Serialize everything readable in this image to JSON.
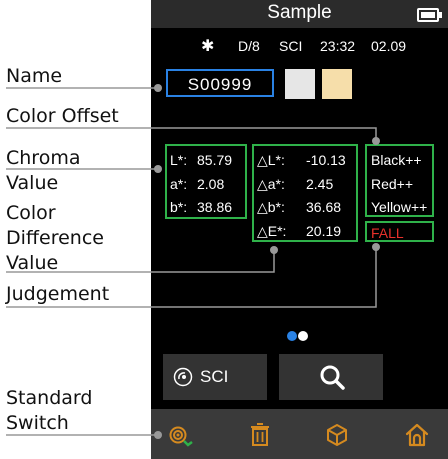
{
  "callouts": {
    "name": "Name",
    "color_offset": "Color Offset",
    "chroma_1": "Chroma",
    "chroma_2": "Value",
    "difference_1": "Color",
    "difference_2": "Difference",
    "difference_3": "Value",
    "judgement": "Judgement",
    "standard_1": "Standard",
    "standard_2": "Switch"
  },
  "header": {
    "title": "Sample",
    "battery_icon": "battery-full-icon"
  },
  "status": {
    "bluetooth_icon": "bluetooth-icon",
    "bluetooth_glyph": "✱",
    "geometry": "D/8",
    "mode": "SCI",
    "time": "23:32",
    "date": "02.09"
  },
  "sample": {
    "name": "S00999",
    "swatches": [
      "#e6e6e6",
      "#f6deaa"
    ]
  },
  "chroma": [
    {
      "label": "L*:",
      "value": "85.79"
    },
    {
      "label": "a*:",
      "value": "2.08"
    },
    {
      "label": "b*:",
      "value": "38.86"
    }
  ],
  "difference": [
    {
      "label": "△L*:",
      "value": "-10.13"
    },
    {
      "label": "△a*:",
      "value": "2.45"
    },
    {
      "label": "△b*:",
      "value": "36.68"
    },
    {
      "label": "△E*:",
      "value": "20.19"
    }
  ],
  "offset": [
    "Black++",
    "Red++",
    "Yellow++"
  ],
  "judgement": {
    "text": "FALL",
    "color": "#e8312b"
  },
  "pager": {
    "pages": 2,
    "active": 1
  },
  "buttons": {
    "sci_label": "SCI",
    "sci_icon": "measure-mode-icon",
    "search_icon": "search-icon"
  },
  "toolbar": {
    "items": [
      "standard-switch-icon",
      "trash-icon",
      "box-icon",
      "home-icon"
    ]
  },
  "colors": {
    "accent_green": "#2fb24a",
    "accent_blue": "#2a82e4",
    "callout_line": "#999999"
  }
}
